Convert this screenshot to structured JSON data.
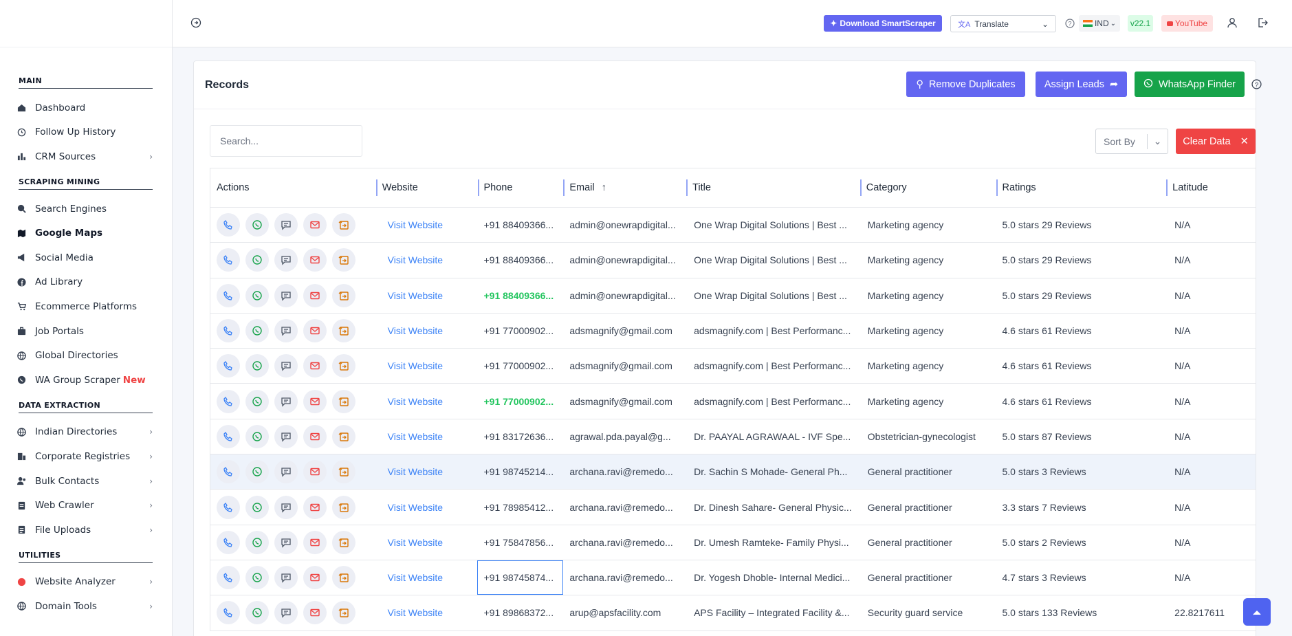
{
  "sidebar": {
    "sections": [
      {
        "title": "MAIN",
        "items": [
          {
            "label": "Dashboard",
            "icon": "home-icon",
            "chevron": false
          },
          {
            "label": "Follow Up History",
            "icon": "history-icon",
            "chevron": false
          },
          {
            "label": "CRM Sources",
            "icon": "bar-chart-icon",
            "chevron": true
          }
        ]
      },
      {
        "title": "SCRAPING MINING",
        "items": [
          {
            "label": "Search Engines",
            "icon": "search-icon",
            "chevron": false
          },
          {
            "label": "Google Maps",
            "icon": "map-icon",
            "chevron": false,
            "active": true
          },
          {
            "label": "Social Media",
            "icon": "megaphone-icon",
            "chevron": false
          },
          {
            "label": "Ad Library",
            "icon": "facebook-icon",
            "chevron": false
          },
          {
            "label": "Ecommerce Platforms",
            "icon": "cart-icon",
            "chevron": false
          },
          {
            "label": "Job Portals",
            "icon": "briefcase-icon",
            "chevron": false
          },
          {
            "label": "Global Directories",
            "icon": "globe-icon",
            "chevron": false
          },
          {
            "label": "WA Group Scraper",
            "icon": "whatsapp-icon",
            "chevron": false,
            "badge": "New"
          }
        ]
      },
      {
        "title": "DATA EXTRACTION",
        "items": [
          {
            "label": "Indian Directories",
            "icon": "globe-icon",
            "chevron": true
          },
          {
            "label": "Corporate Registries",
            "icon": "building-icon",
            "chevron": true
          },
          {
            "label": "Bulk Contacts",
            "icon": "users-icon",
            "chevron": true
          },
          {
            "label": "Web Crawler",
            "icon": "file-icon",
            "chevron": true
          },
          {
            "label": "File Uploads",
            "icon": "upload-icon",
            "chevron": true
          }
        ]
      },
      {
        "title": "UTILITIES",
        "items": [
          {
            "label": "Website Analyzer",
            "icon": "red-dot-icon",
            "chevron": true
          },
          {
            "label": "Domain Tools",
            "icon": "globe-icon",
            "chevron": true
          }
        ]
      }
    ]
  },
  "topbar": {
    "download_label": "Download SmartScraper",
    "translate_label": "Translate",
    "country_label": "IND",
    "version": "v22.1",
    "youtube_label": "YouTube"
  },
  "records": {
    "title": "Records",
    "remove_duplicates": "Remove Duplicates",
    "assign_leads": "Assign Leads",
    "whatsapp_finder": "WhatsApp Finder",
    "search_placeholder": "Search...",
    "sort_by": "Sort By",
    "clear_data": "Clear Data",
    "columns": [
      "Actions",
      "Website",
      "Phone",
      "Email",
      "Title",
      "Category",
      "Ratings",
      "Latitude"
    ],
    "rows": [
      {
        "website": "Visit Website",
        "phone": "+91 88409366...",
        "email": "admin@onewrapdigital...",
        "title": "One Wrap Digital Solutions | Best ...",
        "category": "Marketing agency",
        "ratings": "5.0 stars 29 Reviews",
        "latitude": "N/A"
      },
      {
        "website": "Visit Website",
        "phone": "+91 88409366...",
        "email": "admin@onewrapdigital...",
        "title": "One Wrap Digital Solutions | Best ...",
        "category": "Marketing agency",
        "ratings": "5.0 stars 29 Reviews",
        "latitude": "N/A"
      },
      {
        "website": "Visit Website",
        "phone": "+91 88409366...",
        "email": "admin@onewrapdigital...",
        "title": "One Wrap Digital Solutions | Best ...",
        "category": "Marketing agency",
        "ratings": "5.0 stars 29 Reviews",
        "latitude": "N/A",
        "phone_green": true
      },
      {
        "website": "Visit Website",
        "phone": "+91 77000902...",
        "email": "adsmagnify@gmail.com",
        "title": "adsmagnify.com | Best Performanc...",
        "category": "Marketing agency",
        "ratings": "4.6 stars 61 Reviews",
        "latitude": "N/A"
      },
      {
        "website": "Visit Website",
        "phone": "+91 77000902...",
        "email": "adsmagnify@gmail.com",
        "title": "adsmagnify.com | Best Performanc...",
        "category": "Marketing agency",
        "ratings": "4.6 stars 61 Reviews",
        "latitude": "N/A"
      },
      {
        "website": "Visit Website",
        "phone": "+91 77000902...",
        "email": "adsmagnify@gmail.com",
        "title": "adsmagnify.com | Best Performanc...",
        "category": "Marketing agency",
        "ratings": "4.6 stars 61 Reviews",
        "latitude": "N/A",
        "phone_green": true
      },
      {
        "website": "Visit Website",
        "phone": "+91 83172636...",
        "email": "agrawal.pda.payal@g...",
        "title": "Dr. PAAYAL AGRAWAAL - IVF Spe...",
        "category": "Obstetrician-gynecologist",
        "ratings": "5.0 stars 87 Reviews",
        "latitude": "N/A"
      },
      {
        "website": "Visit Website",
        "phone": "+91 98745214...",
        "email": "archana.ravi@remedo...",
        "title": "Dr. Sachin S Mohade- General Ph...",
        "category": "General practitioner",
        "ratings": "5.0 stars 3 Reviews",
        "latitude": "N/A",
        "highlight": true
      },
      {
        "website": "Visit Website",
        "phone": "+91 78985412...",
        "email": "archana.ravi@remedo...",
        "title": "Dr. Dinesh Sahare- General Physic...",
        "category": "General practitioner",
        "ratings": "3.3 stars 7 Reviews",
        "latitude": "N/A"
      },
      {
        "website": "Visit Website",
        "phone": "+91 75847856...",
        "email": "archana.ravi@remedo...",
        "title": "Dr. Umesh Ramteke- Family Physi...",
        "category": "General practitioner",
        "ratings": "5.0 stars 2 Reviews",
        "latitude": "N/A"
      },
      {
        "website": "Visit Website",
        "phone": "+91 98745874...",
        "email": "archana.ravi@remedo...",
        "title": "Dr. Yogesh Dhoble- Internal Medici...",
        "category": "General practitioner",
        "ratings": "4.7 stars 3 Reviews",
        "latitude": "N/A",
        "phone_selected": true
      },
      {
        "website": "Visit Website",
        "phone": "+91 89868372...",
        "email": "arup@apsfacility.com",
        "title": "APS Facility – Integrated Facility &...",
        "category": "Security guard service",
        "ratings": "5.0 stars 133 Reviews",
        "latitude": "22.8217611"
      }
    ]
  },
  "colors": {
    "accent": "#6366f1",
    "whatsapp": "#16a34a",
    "danger": "#ef4444"
  }
}
